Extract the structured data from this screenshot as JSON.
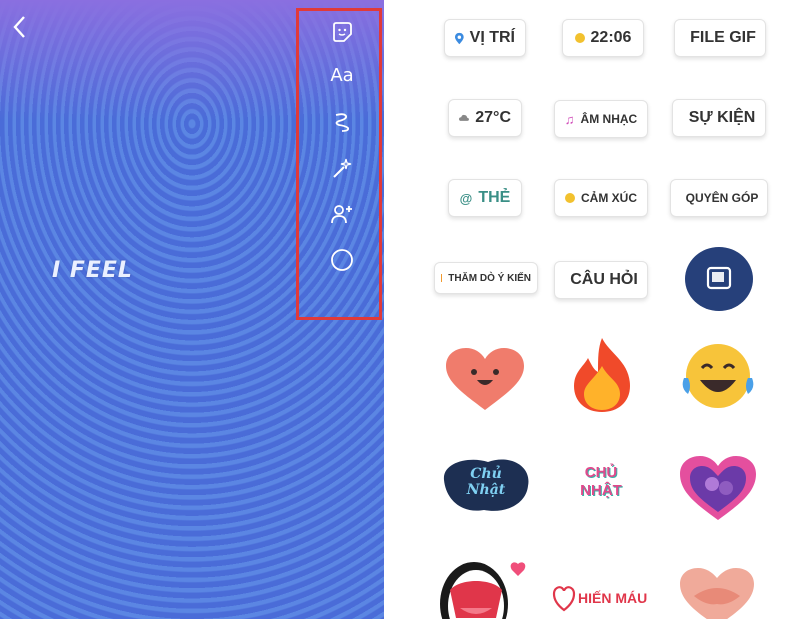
{
  "story": {
    "back_icon": "chevron-left-icon",
    "overlay_text": "I FEEL"
  },
  "tools": [
    {
      "name": "sticker-tool",
      "icon": "sticker-icon"
    },
    {
      "name": "text-tool",
      "label": "Aa"
    },
    {
      "name": "draw-tool",
      "icon": "squiggle-icon"
    },
    {
      "name": "effects-tool",
      "icon": "magic-wand-icon"
    },
    {
      "name": "tag-people-tool",
      "icon": "add-person-icon"
    },
    {
      "name": "circle-tool",
      "icon": "circle-icon"
    }
  ],
  "stickers": {
    "location": "VỊ TRÍ",
    "time": "22:06",
    "gif": "FILE GIF",
    "temperature": "27°C",
    "music": "ÂM NHẠC",
    "event": "SỰ KIỆN",
    "tag": "THẺ",
    "feeling": "CẢM XÚC",
    "donation": "QUYÊN GÓP",
    "poll": "THĂM DÒ Ý KIẾN",
    "question": "CÂU HỎI",
    "photo_icon": "photo-sticker-icon",
    "heart_icon": "heart-face-icon",
    "fire_icon": "fire-icon",
    "laugh_icon": "laughing-emoji-icon",
    "sunday_1": "Chủ Nhật",
    "sunday_2": "CHỦ NHẬT",
    "love_icon": "purple-heart-icon",
    "mouth_icon": "mouth-icon",
    "blood": "HIẾN MÁU",
    "hug_icon": "hug-heart-icon"
  },
  "colors": {
    "highlight": "#e03a3a",
    "story_bg": "#4f70dc",
    "photo_bg": "#26407a"
  }
}
